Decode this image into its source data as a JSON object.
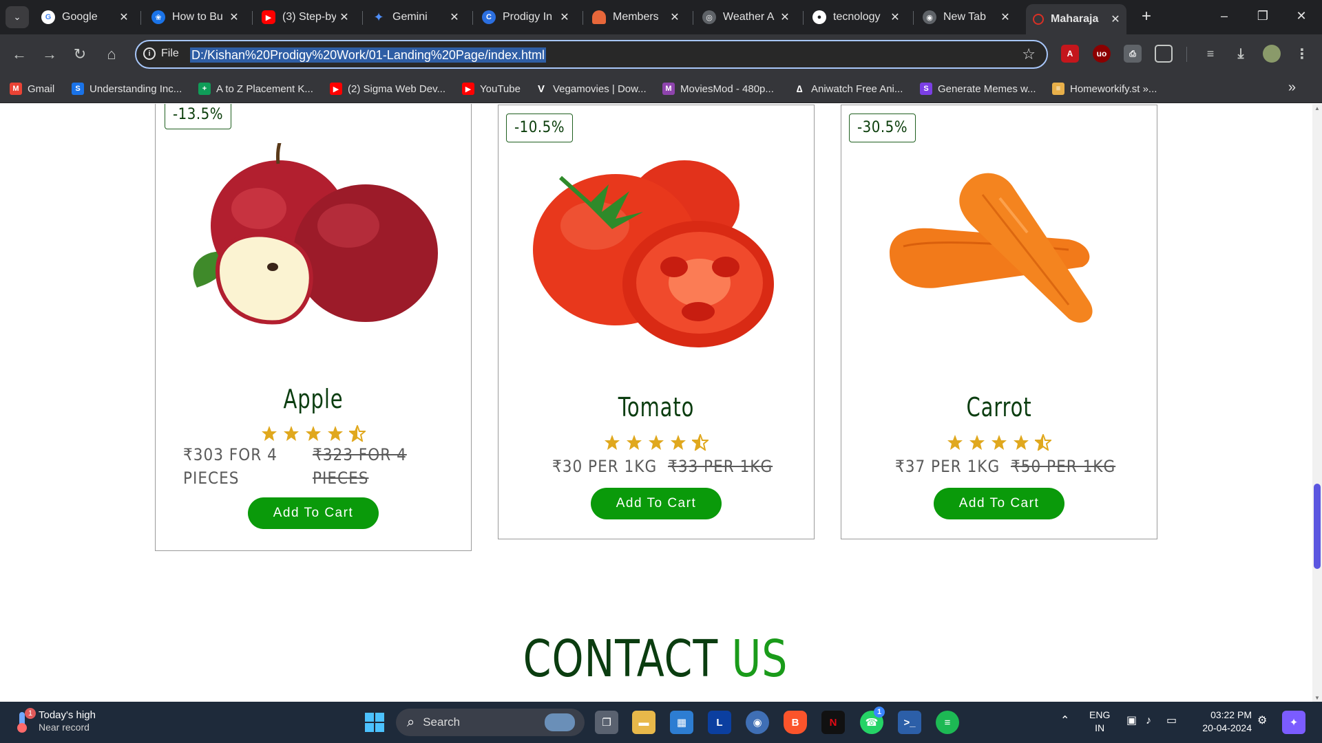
{
  "browser": {
    "tabs": [
      {
        "title": "Google",
        "icon": "google-icon",
        "color": "#ffffff"
      },
      {
        "title": "How to Bu",
        "icon": "cat-icon",
        "color": "#1a73e8"
      },
      {
        "title": "(3) Step-by",
        "icon": "youtube-icon",
        "color": "#ff0000"
      },
      {
        "title": "Gemini",
        "icon": "gemini-icon",
        "color": "#4f8ef7"
      },
      {
        "title": "Prodigy In",
        "icon": "prodigy-icon",
        "color": "#2b6fe0"
      },
      {
        "title": "Members",
        "icon": "members-icon",
        "color": "#e8673a"
      },
      {
        "title": "Weather A",
        "icon": "globe-icon",
        "color": "#bdc1c6"
      },
      {
        "title": "tecnology",
        "icon": "github-icon",
        "color": "#ffffff"
      },
      {
        "title": "New Tab",
        "icon": "chrome-icon",
        "color": "#bdc1c6"
      },
      {
        "title": "Maharaja",
        "icon": "maharaja-icon",
        "color": "#d93025"
      }
    ],
    "address": {
      "scheme_label": "File",
      "url": "D:/Kishan%20Prodigy%20Work/01-Landing%20Page/index.html"
    },
    "bookmarks": [
      {
        "label": "Gmail",
        "icon": "gmail-icon",
        "color": "#ea4335"
      },
      {
        "label": "Understanding Inc...",
        "icon": "s-icon",
        "color": "#1a73e8"
      },
      {
        "label": "A to Z Placement K...",
        "icon": "sheets-icon",
        "color": "#0f9d58"
      },
      {
        "label": "(2) Sigma Web Dev...",
        "icon": "youtube-icon",
        "color": "#ff0000"
      },
      {
        "label": "YouTube",
        "icon": "youtube-icon",
        "color": "#ff0000"
      },
      {
        "label": "Vegamovies | Dow...",
        "icon": "v-icon",
        "color": "#ffffff"
      },
      {
        "label": "MoviesMod - 480p...",
        "icon": "m-icon",
        "color": "#8e44ad"
      },
      {
        "label": "Aniwatch Free Ani...",
        "icon": "aniwatch-icon",
        "color": "#ffffff"
      },
      {
        "label": "Generate Memes w...",
        "icon": "s-purple-icon",
        "color": "#7b3fe4"
      },
      {
        "label": "Homeworkify.st »...",
        "icon": "homework-icon",
        "color": "#e8b04a"
      }
    ]
  },
  "products": [
    {
      "name": "Apple",
      "discount": "-13.5%",
      "price_now": "₹303 FOR 4 PIECES",
      "price_old": "₹323 FOR 4 PIECES",
      "rating": 4.5,
      "cart_label": "Add To Cart"
    },
    {
      "name": "Tomato",
      "discount": "-10.5%",
      "price_now": "₹30 PER 1KG",
      "price_old": "₹33 PER 1KG",
      "rating": 4.5,
      "cart_label": "Add To Cart"
    },
    {
      "name": "Carrot",
      "discount": "-30.5%",
      "price_now": "₹37 PER 1KG",
      "price_old": "₹50 PER 1KG",
      "rating": 4.5,
      "cart_label": "Add To Cart"
    }
  ],
  "contact": {
    "title_main": "CONTACT",
    "title_accent": "US"
  },
  "colors": {
    "brand_dark": "#0b3d10",
    "brand_green": "#0a9a0a",
    "star": "#e0a81e"
  },
  "taskbar": {
    "weather_title": "Today's high",
    "weather_sub": "Near record",
    "weather_badge": "1",
    "search_placeholder": "Search",
    "whatsapp_badge": "1",
    "lang_top": "ENG",
    "lang_bottom": "IN",
    "time": "03:22 PM",
    "date": "20-04-2024"
  }
}
